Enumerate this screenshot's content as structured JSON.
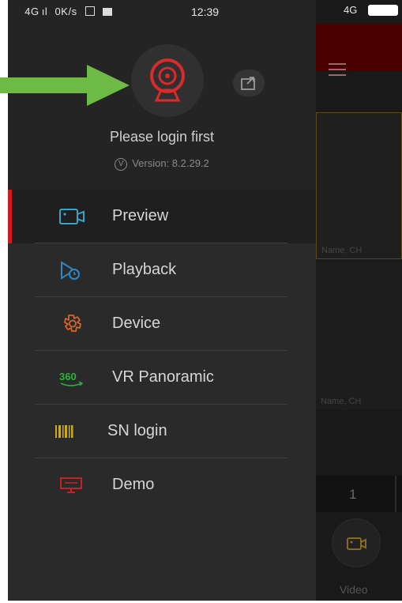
{
  "status_bar": {
    "left": "   4G ıl   0K/s",
    "time": "12:39",
    "right": "4G"
  },
  "drawer": {
    "login_prompt": "Please login first",
    "version": "Version: 8.2.29.2",
    "menu": [
      {
        "label": "Preview",
        "icon": "camera-icon",
        "color": "#35a6c9",
        "active": true
      },
      {
        "label": "Playback",
        "icon": "playback-icon",
        "color": "#2f86c8"
      },
      {
        "label": "Device",
        "icon": "gear-icon",
        "color": "#d7662a"
      },
      {
        "label": "VR Panoramic",
        "icon": "vr-360-icon",
        "color": "#2bb33a"
      },
      {
        "label": "SN login",
        "icon": "barcode-icon",
        "color": "#c9a825"
      },
      {
        "label": "Demo",
        "icon": "demo-screen-icon",
        "color": "#c12424"
      }
    ]
  },
  "background_app": {
    "tile_label_1": "Name, CH",
    "tile_label_2": "Name, CH",
    "page_number": "1",
    "video_label": "Video"
  },
  "colors": {
    "accent": "#d11a1a",
    "annotation_arrow": "#6dbb45"
  }
}
